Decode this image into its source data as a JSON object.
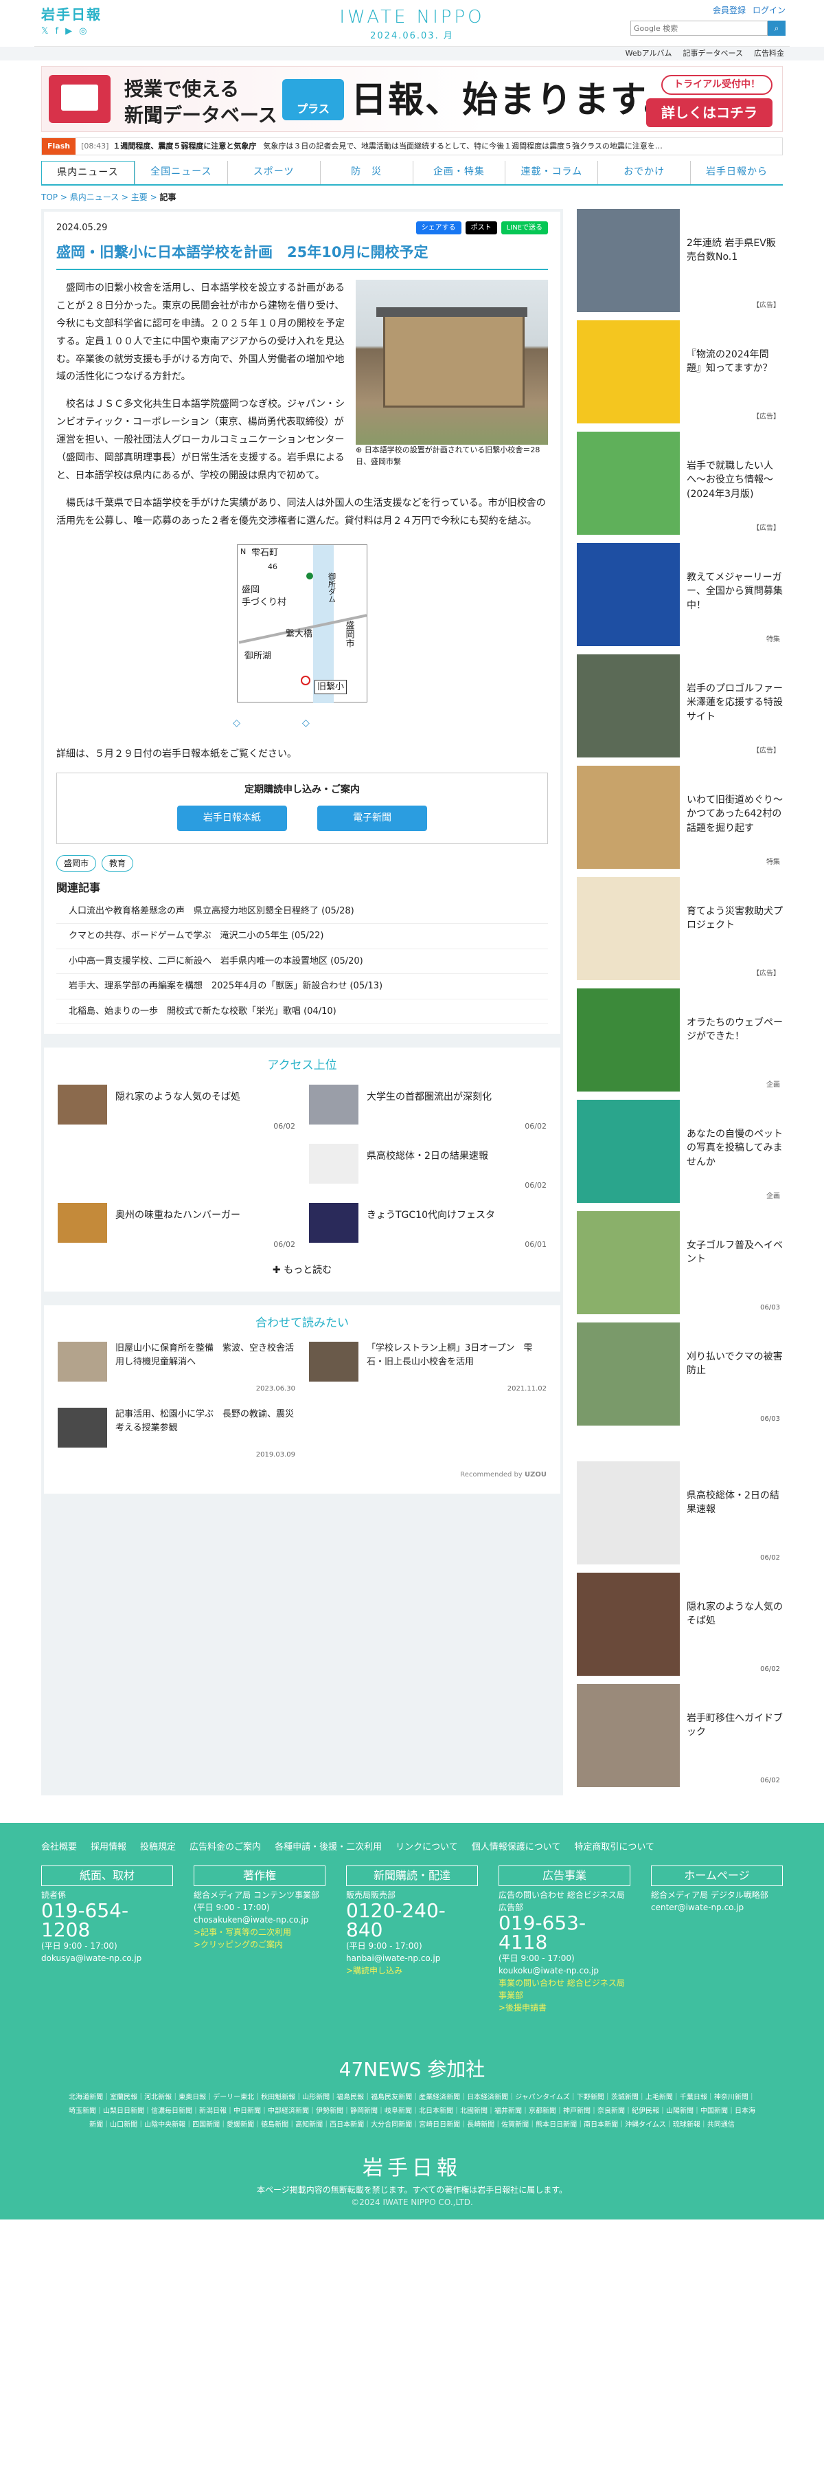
{
  "header": {
    "logo_jp": "岩手日報",
    "logo_en": "IWATE NIPPO",
    "date": "2024.06.03. 月",
    "member": "会員登録",
    "login": "ログイン",
    "search_placeholder": "Google 検索",
    "search_label": "Google"
  },
  "subbar": [
    "Webアルバム",
    "記事データベース",
    "広告料金"
  ],
  "banner": {
    "line1": "授業で使える",
    "line2": "新聞データベース",
    "plus": "プラス",
    "big": "日報、始まります。",
    "trial": "トライアル受付中！",
    "cta": "詳しくはコチラ"
  },
  "flash": {
    "label": "Flash",
    "time": "[08:43]",
    "bold": "１週間程度、震度５弱程度に注意と気象庁",
    "text": "気象庁は３日の記者会見で、地震活動は当面継続するとして、特に今後１週間程度は震度５強クラスの地震に注意を…"
  },
  "nav": [
    "県内ニュース",
    "全国ニュース",
    "スポーツ",
    "防　災",
    "企画・特集",
    "連載・コラム",
    "おでかけ",
    "岩手日報から"
  ],
  "crumb": {
    "a": "TOP",
    "b": "県内ニュース",
    "c": "主要",
    "d": "記事"
  },
  "article": {
    "date": "2024.05.29",
    "share": {
      "fb": "シェアする",
      "x": "ポスト",
      "line": "LINEで送る"
    },
    "title": "盛岡・旧繋小に日本語学校を計画　25年10月に開校予定",
    "caption": "日本語学校の設置が計画されている旧繋小校舎＝28日、盛岡市繋",
    "p1": "盛岡市の旧繋小校舎を活用し、日本語学校を設立する計画があることが２８日分かった。東京の民間会社が市から建物を借り受け、今秋にも文部科学省に認可を申請。２０２５年１０月の開校を予定する。定員１００人で主に中国や東南アジアからの受け入れを見込む。卒業後の就労支援も手がける方向で、外国人労働者の増加や地域の活性化につなげる方針だ。",
    "p2": "校名はＪＳＣ多文化共生日本語学院盛岡つなぎ校。ジャパン・シンビオティック・コーポレーション（東京、楊尚勇代表取締役）が運営を担い、一般社団法人グローカルコミュニケーションセンター（盛岡市、岡部真明理事長）が日常生活を支援する。岩手県によると、日本語学校は県内にあるが、学校の開設は県内で初めて。",
    "p3": "楊氏は千葉県で日本語学校を手がけた実績があり、同法人は外国人の生活支援などを行っている。市が旧校舎の活用先を公募し、唯一応募のあった２者を優先交渉権者に選んだ。貸付料は月２４万円で今秋にも契約を結ぶ。",
    "detail": "詳細は、５月２９日付の岩手日報本紙をご覧ください。",
    "map": {
      "n": "N",
      "l1": "雫石町",
      "l2": "46",
      "l3": "盛岡",
      "l4": "手づくり村",
      "l5": "繋大橋",
      "l6": "御所湖",
      "l7": "盛岡市",
      "l8": "旧繋小",
      "l9": "御所ダム"
    }
  },
  "subscribe": {
    "h": "定期購読申し込み・ご案内",
    "b1": "岩手日報本紙",
    "b2": "電子新聞"
  },
  "tags": [
    "盛岡市",
    "教育"
  ],
  "related": {
    "h": "関連記事",
    "items": [
      "人口流出や教育格差懸念の声　県立高授力地区別懇全日程終了 (05/28)",
      "クマとの共存、ボードゲームで学ぶ　滝沢二小の5年生 (05/22)",
      "小中高一貫支援学校、二戸に新設へ　岩手県内唯一の本設置地区 (05/20)",
      "岩手大、理系学部の再編案を構想　2025年4月の「獣医」新設合わせ (05/13)",
      "北稲島、始まりの一歩　開校式で新たな校歌「栄光」歌唱 (04/10)"
    ]
  },
  "access": {
    "h": "アクセス上位",
    "items": [
      {
        "t": "隠れ家のような人気のそば処",
        "d": "06/02"
      },
      {
        "t": "大学生の首都圏流出が深刻化",
        "d": "06/02"
      },
      {
        "t": "",
        "d": ""
      },
      {
        "t": "県高校総体・2日の結果速報",
        "d": "06/02"
      },
      {
        "t": "奥州の味重ねたハンバーガー",
        "d": "06/02"
      },
      {
        "t": "きょうTGC10代向けフェスタ",
        "d": "06/01"
      }
    ],
    "more": "もっと読む"
  },
  "also": {
    "h": "合わせて読みたい",
    "items": [
      {
        "t": "旧屋山小に保育所を整備　紫波、空き校舎活用し待機児童解消へ",
        "d": "2023.06.30"
      },
      {
        "t": "「学校レストラン上桐」3日オープン　雫石・旧上長山小校舎を活用",
        "d": "2021.11.02"
      },
      {
        "t": "記事活用、松園小に学ぶ　長野の教諭、震災考える授業参観",
        "d": "2019.03.09"
      }
    ],
    "rec": "Recommended by",
    "rec_brand": "UZOU"
  },
  "side": [
    {
      "t": "2年連続 岩手県EV販売台数No.1",
      "tag": "【広告】",
      "c": "#6a7a8a"
    },
    {
      "t": "『物流の2024年問題』知ってますか？",
      "tag": "【広告】",
      "c": "#f4c61f"
    },
    {
      "t": "岩手で就職したい人へ〜お役立ち情報〜(2024年3月版)",
      "tag": "【広告】",
      "c": "#5fb05a"
    },
    {
      "t": "教えてメジャーリーガー、全国から質問募集中！",
      "tag": "特集",
      "c": "#1e4fa3"
    },
    {
      "t": "岩手のプロゴルファー米澤蓮を応援する特設サイト",
      "tag": "【広告】",
      "c": "#5b6a56"
    },
    {
      "t": "いわて旧街道めぐり〜かつてあった642村の話題を掘り起す",
      "tag": "特集",
      "c": "#c8a36a"
    },
    {
      "t": "育てよう災害救助犬プロジェクト",
      "tag": "【広告】",
      "c": "#eee2c8"
    },
    {
      "t": "オラたちのウェブページができた！",
      "tag": "企画",
      "c": "#3c8a3a"
    },
    {
      "t": "あなたの自慢のペットの写真を投稿してみませんか",
      "tag": "企画",
      "c": "#2aa58c"
    },
    {
      "t": "女子ゴルフ普及へイベント",
      "tag": "06/03",
      "c": "#8ab06a"
    },
    {
      "t": "刈り払いでクマの被害防止",
      "tag": "06/03",
      "c": "#7a9a6a"
    }
  ],
  "side2": [
    {
      "t": "県高校総体・2日の結果速報",
      "tag": "06/02",
      "c": "#e8e8e8"
    },
    {
      "t": "隠れ家のような人気のそば処",
      "tag": "06/02",
      "c": "#6a4a3a"
    },
    {
      "t": "岩手町移住へガイドブック",
      "tag": "06/02",
      "c": "#9a8a7a"
    }
  ],
  "footer": {
    "links": [
      "会社概要",
      "採用情報",
      "投稿規定",
      "広告料金のご案内",
      "各種申請・後援・二次利用",
      "リンクについて",
      "個人情報保護について",
      "特定商取引について"
    ],
    "cols": [
      {
        "h": "紙面、取材",
        "a": "読者係",
        "tel": "019-654-1208",
        "hours": "(平日 9:00 - 17:00)",
        "mail": "dokusya@iwate-np.co.jp",
        "l1": "",
        "l2": ""
      },
      {
        "h": "著作権",
        "a": "総合メディア局 コンテンツ事業部",
        "tel": "",
        "hours": "(平日 9:00 - 17:00)",
        "mail": "chosakuken@iwate-np.co.jp",
        "l1": ">記事・写真等の二次利用",
        "l2": ">クリッピングのご案内"
      },
      {
        "h": "新聞購読・配達",
        "a": "販売局販売部",
        "tel": "0120-240-840",
        "hours": "(平日 9:00 - 17:00)",
        "mail": "hanbai@iwate-np.co.jp",
        "l1": ">購読申し込み",
        "l2": ""
      },
      {
        "h": "広告事業",
        "a": "広告の問い合わせ 総合ビジネス局広告部",
        "tel": "019-653-4118",
        "hours": "(平日 9:00 - 17:00)",
        "mail": "koukoku@iwate-np.co.jp",
        "l1": "事業の問い合わせ 総合ビジネス局事業部",
        "l2": ">後援申請書"
      },
      {
        "h": "ホームページ",
        "a": "総合メディア局 デジタル戦略部",
        "tel": "",
        "hours": "",
        "mail": "center@iwate-np.co.jp",
        "l1": "",
        "l2": ""
      }
    ],
    "n47": "47NEWS 参加社",
    "members": "北海道新聞｜室蘭民報｜河北新報｜東奥日報｜デーリー東北｜秋田魁新報｜山形新聞｜福島民報｜福島民友新聞｜産業経済新聞｜日本経済新聞｜ジャパンタイムズ｜下野新聞｜茨城新聞｜上毛新聞｜千葉日報｜神奈川新聞｜埼玉新聞｜山梨日日新聞｜信濃毎日新聞｜新潟日報｜中日新聞｜中部経済新聞｜伊勢新聞｜静岡新聞｜岐阜新聞｜北日本新聞｜北國新聞｜福井新聞｜京都新聞｜神戸新聞｜奈良新聞｜紀伊民報｜山陽新聞｜中国新聞｜日本海新聞｜山口新聞｜山陰中央新報｜四国新聞｜愛媛新聞｜徳島新聞｜高知新聞｜西日本新聞｜大分合同新聞｜宮崎日日新聞｜長崎新聞｜佐賀新聞｜熊本日日新聞｜南日本新聞｜沖縄タイムス｜琉球新報｜共同通信",
    "logo": "岩手日報",
    "note": "本ページ掲載内容の無断転載を禁じます。すべての著作権は岩手日報社に属します。",
    "copy": "©2024 IWATE NIPPO CO.,LTD."
  }
}
